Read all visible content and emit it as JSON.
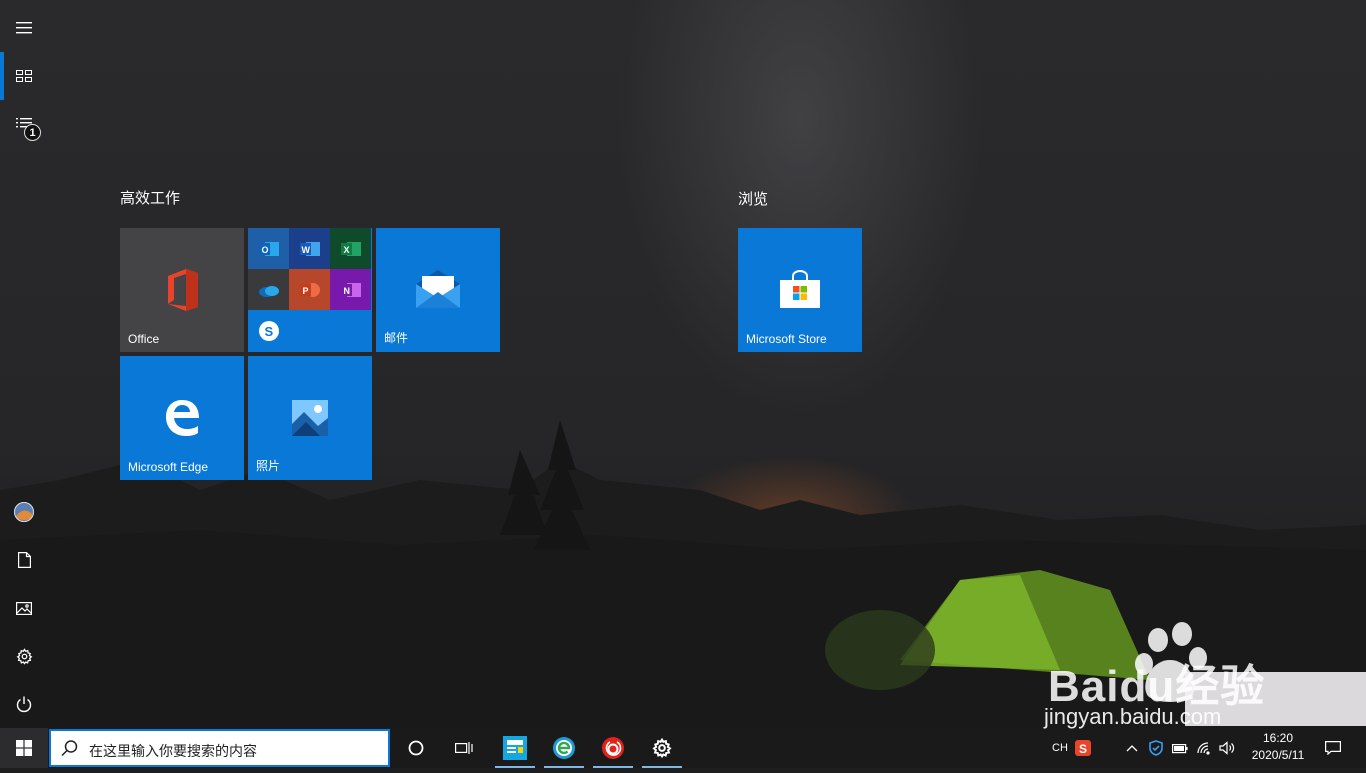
{
  "start_menu": {
    "groups": [
      {
        "title": "高效工作"
      },
      {
        "title": "浏览"
      }
    ],
    "tiles": {
      "office": "Office",
      "mail": "邮件",
      "edge": "Microsoft Edge",
      "photos": "照片",
      "store": "Microsoft Store"
    },
    "sidebar": {
      "items": [
        "menu-icon",
        "all-apps-icon",
        "recent-icon",
        "user-avatar",
        "documents-icon",
        "pictures-icon",
        "settings-icon",
        "power-icon"
      ],
      "badge": "1"
    }
  },
  "taskbar": {
    "search_placeholder": "在这里输入你要搜索的内容",
    "tray": {
      "ime": "CH",
      "time": "16:20",
      "date": "2020/5/11"
    }
  },
  "watermark": {
    "brand": "Baidu经验",
    "url": "jingyan.baidu.com"
  },
  "colors": {
    "accent": "#0a78d7",
    "office_tile": "#444446",
    "taskbar": "#1a1a1b"
  }
}
